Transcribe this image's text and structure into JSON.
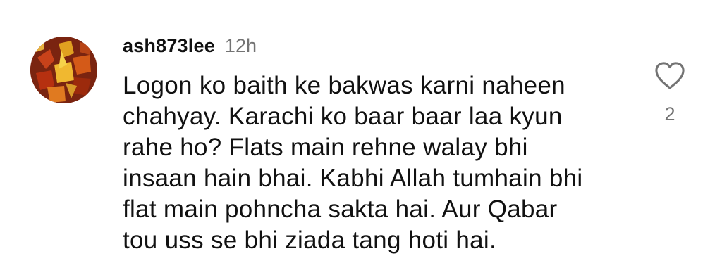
{
  "comment": {
    "username": "ash873lee",
    "timestamp": "12h",
    "text_lines": [
      "Logon ko baith ke bakwas karni naheen",
      "chahyay. Karachi ko baar baar laa kyun",
      "rahe ho? Flats main rehne walay bhi",
      "insaan hain bhai. Kabhi Allah tumhain bhi",
      "flat main pohncha sakta hai. Aur Qabar",
      "tou uss se bhi ziada tang hoti hai."
    ],
    "like_count": "2",
    "avatar_icon": "autumn-leaves-avatar",
    "like_icon": "heart-outline-icon"
  },
  "colors": {
    "text": "#111111",
    "secondary": "#737373",
    "background": "#ffffff"
  }
}
